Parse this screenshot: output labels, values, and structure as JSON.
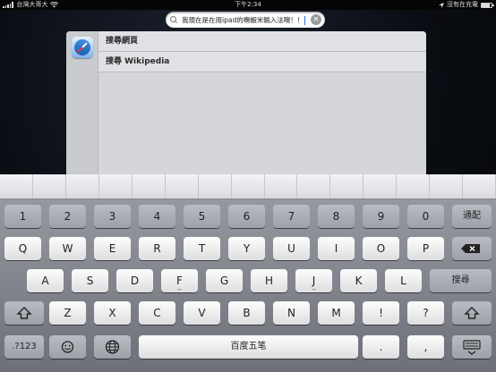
{
  "status_bar": {
    "carrier": "台灣大哥大",
    "time": "下午2:34",
    "charging": "沒有在充電",
    "icons": [
      "signal-icon",
      "wifi-icon",
      "location-icon",
      "battery-icon"
    ]
  },
  "search": {
    "value": "我現在是在用ipad的嘸蝦米輸入法噢！！",
    "icon": "search-icon",
    "clear_icon": "clear-icon"
  },
  "suggestions": {
    "app_icon": "safari-icon",
    "items": [
      {
        "label": "搜尋網頁"
      },
      {
        "label": "搜尋 Wikipedia"
      }
    ]
  },
  "keyboard": {
    "candidate_slots": 15,
    "row_numbers": [
      "1",
      "2",
      "3",
      "4",
      "5",
      "6",
      "7",
      "8",
      "9",
      "0"
    ],
    "key_done": "通配",
    "row_qwerty": [
      "Q",
      "W",
      "E",
      "R",
      "T",
      "Y",
      "U",
      "I",
      "O",
      "P"
    ],
    "row_home": [
      "A",
      "S",
      "D",
      "F",
      "G",
      "H",
      "J",
      "K",
      "L"
    ],
    "key_search": "搜尋",
    "row_bottom": [
      "Z",
      "X",
      "C",
      "V",
      "B",
      "N",
      "M",
      "!",
      "?"
    ],
    "key_mode": ".?123",
    "key_space": "百度五笔",
    "icons": {
      "backspace": "backspace-icon",
      "shift": "shift-icon",
      "emoji": "emoji-icon",
      "globe": "globe-icon",
      "dismiss": "keyboard-dismiss-icon"
    },
    "home_subs": {
      "F": "_",
      "J": "_"
    }
  }
}
